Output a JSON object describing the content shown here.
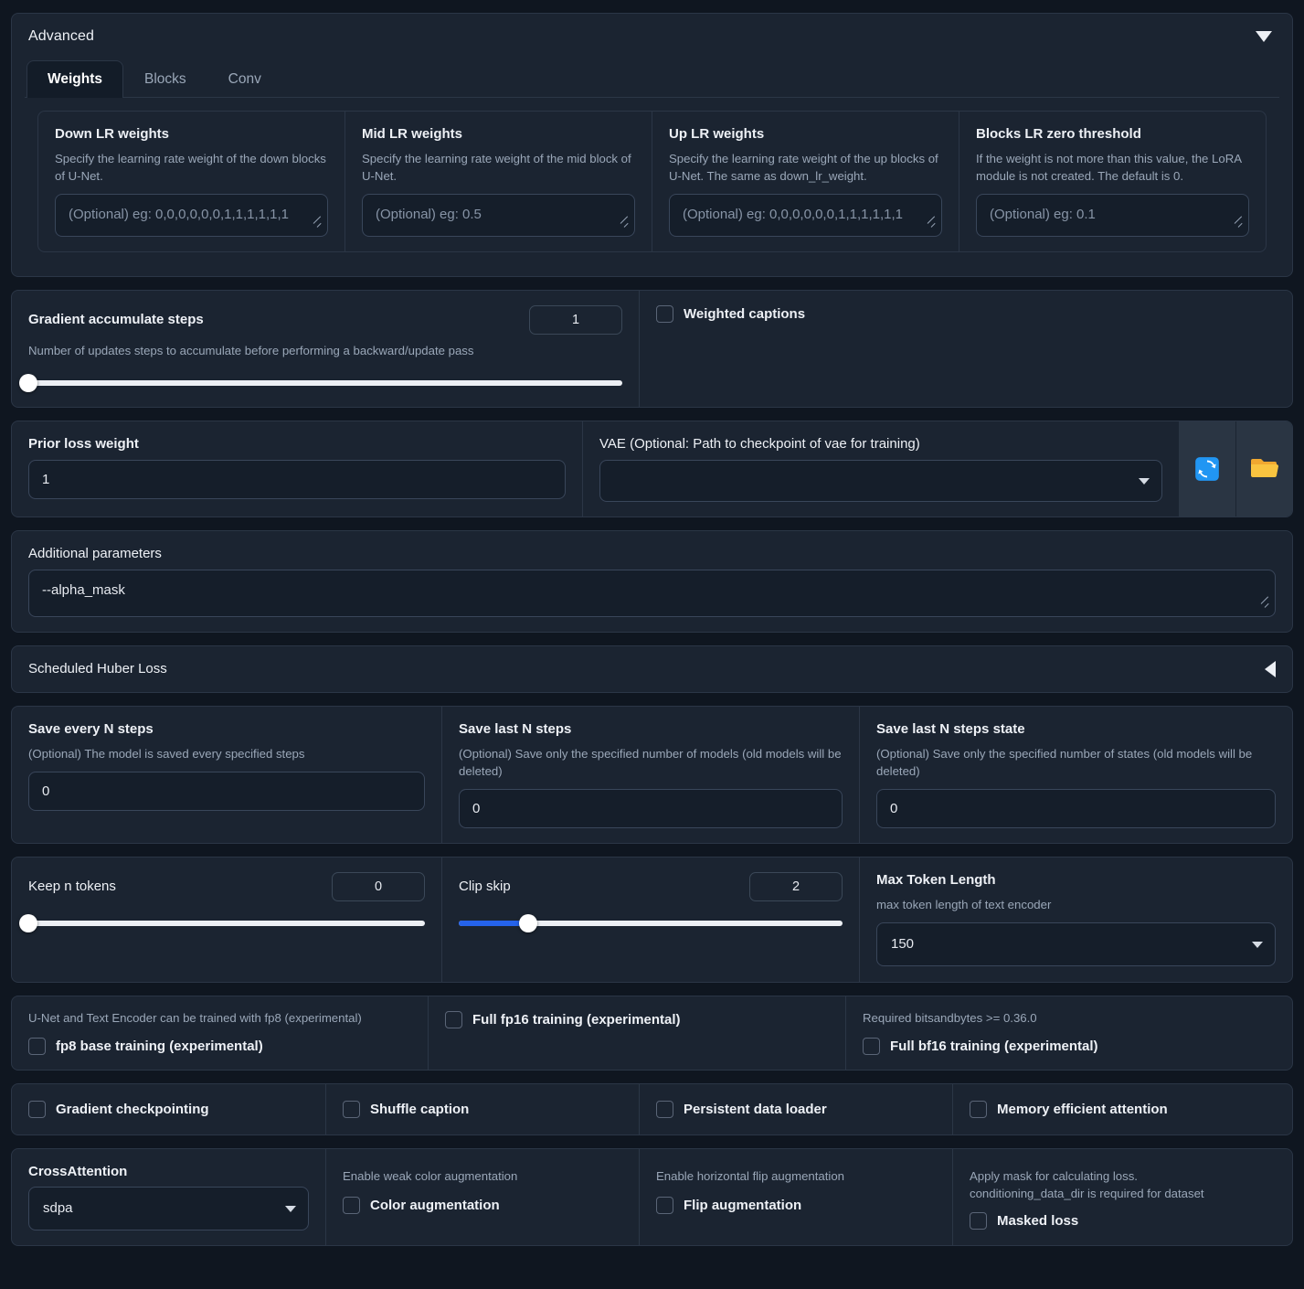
{
  "accordion": {
    "title": "Advanced",
    "expand_icon": "chevron-down-icon"
  },
  "tabs": [
    {
      "label": "Weights",
      "active": true
    },
    {
      "label": "Blocks",
      "active": false
    },
    {
      "label": "Conv",
      "active": false
    }
  ],
  "weights": [
    {
      "label": "Down LR weights",
      "info": "Specify the learning rate weight of the down blocks of U-Net.",
      "placeholder": "(Optional) eg: 0,0,0,0,0,0,1,1,1,1,1,1",
      "value": ""
    },
    {
      "label": "Mid LR weights",
      "info": "Specify the learning rate weight of the mid block of U-Net.",
      "placeholder": "(Optional) eg: 0.5",
      "value": ""
    },
    {
      "label": "Up LR weights",
      "info": "Specify the learning rate weight of the up blocks of U-Net. The same as down_lr_weight.",
      "placeholder": "(Optional) eg: 0,0,0,0,0,0,1,1,1,1,1,1",
      "value": ""
    },
    {
      "label": "Blocks LR zero threshold",
      "info": "If the weight is not more than this value, the LoRA module is not created. The default is 0.",
      "placeholder": "(Optional) eg: 0.1",
      "value": ""
    }
  ],
  "gradient_accumulate": {
    "label": "Gradient accumulate steps",
    "info": "Number of updates steps to accumulate before performing a backward/update pass",
    "value": "1",
    "percent": 0
  },
  "weighted_captions": {
    "label": "Weighted captions",
    "checked": false
  },
  "prior_loss_weight": {
    "label": "Prior loss weight",
    "value": "1"
  },
  "vae": {
    "label": "VAE (Optional: Path to checkpoint of vae for training)",
    "value": "",
    "refresh_icon": "refresh-icon",
    "folder_icon": "folder-icon"
  },
  "additional_parameters": {
    "label": "Additional parameters",
    "value": "--alpha_mask"
  },
  "huber": {
    "title": "Scheduled Huber Loss",
    "collapse_icon": "chevron-left-icon"
  },
  "save_steps": [
    {
      "label": "Save every N steps",
      "info": "(Optional) The model is saved every specified steps",
      "value": "0"
    },
    {
      "label": "Save last N steps",
      "info": "(Optional) Save only the specified number of models (old models will be deleted)",
      "value": "0"
    },
    {
      "label": "Save last N steps state",
      "info": "(Optional) Save only the specified number of states (old models will be deleted)",
      "value": "0"
    }
  ],
  "keep_n_tokens": {
    "label": "Keep n tokens",
    "value": "0",
    "percent": 0
  },
  "clip_skip": {
    "label": "Clip skip",
    "value": "2",
    "percent": 18
  },
  "max_token_length": {
    "label": "Max Token Length",
    "info": "max token length of text encoder",
    "value": "150"
  },
  "fp_row": {
    "fp8_info": "U-Net and Text Encoder can be trained with fp8 (experimental)",
    "fp8_label": "fp8 base training (experimental)",
    "fp8_checked": false,
    "fp16_label": "Full fp16 training (experimental)",
    "fp16_checked": false,
    "bf16_info": "Required bitsandbytes >= 0.36.0",
    "bf16_label": "Full bf16 training (experimental)",
    "bf16_checked": false
  },
  "toggles": [
    {
      "label": "Gradient checkpointing",
      "checked": false
    },
    {
      "label": "Shuffle caption",
      "checked": false
    },
    {
      "label": "Persistent data loader",
      "checked": false
    },
    {
      "label": "Memory efficient attention",
      "checked": false
    }
  ],
  "bottom": {
    "cross_attention_label": "CrossAttention",
    "cross_attention_value": "sdpa",
    "color_aug_info": "Enable weak color augmentation",
    "color_aug_label": "Color augmentation",
    "color_aug_checked": false,
    "flip_aug_info": "Enable horizontal flip augmentation",
    "flip_aug_label": "Flip augmentation",
    "flip_aug_checked": false,
    "masked_loss_info_line1": "Apply mask for calculating loss.",
    "masked_loss_info_line2": "conditioning_data_dir is required for dataset",
    "masked_loss_label": "Masked loss",
    "masked_loss_checked": false
  },
  "colors": {
    "accent": "#2563eb",
    "panel": "#1b2431",
    "background": "#0f1620",
    "refresh_icon": "#2196f3",
    "folder_icon": "#f5b93a"
  }
}
